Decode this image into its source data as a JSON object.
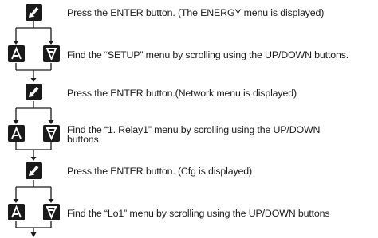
{
  "steps": [
    {
      "key": "enter",
      "icon": "enter-key-icon",
      "text": "Press the ENTER button. (The ENERGY menu is displayed)"
    },
    {
      "key": "up-down",
      "icons": [
        "up-arrow-icon",
        "down-arrow-icon"
      ],
      "text": "Find the “SETUP” menu by scrolling using the UP/DOWN buttons."
    },
    {
      "key": "enter",
      "icon": "enter-key-icon",
      "text": "Press the ENTER button.(Network menu is displayed)"
    },
    {
      "key": "up-down",
      "icons": [
        "up-arrow-icon",
        "down-arrow-icon"
      ],
      "text": "Find the “1. Relay1” menu by scrolling using the UP/DOWN buttons."
    },
    {
      "key": "enter",
      "icon": "enter-key-icon",
      "text": "Press the ENTER button. (Cfg is displayed)"
    },
    {
      "key": "up-down",
      "icons": [
        "up-arrow-icon",
        "down-arrow-icon"
      ],
      "text": "Find the “Lo1” menu by scrolling using the UP/DOWN buttons"
    }
  ],
  "colors": {
    "key_fill": "#1a1a1a",
    "line": "#1a1a1a",
    "text": "#1a1a1a",
    "symbol": "#ffffff"
  }
}
